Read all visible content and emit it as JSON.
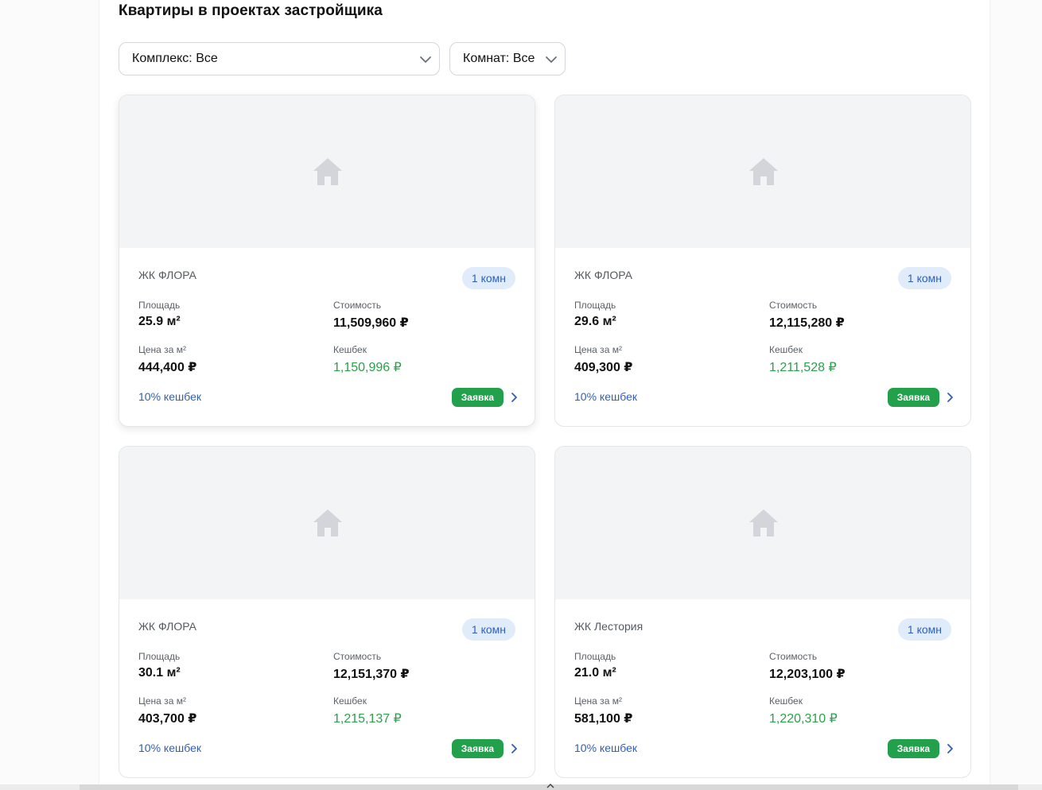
{
  "section": {
    "title": "Квартиры в проектах застройщика"
  },
  "filters": {
    "complex": "Комплекс: Все",
    "rooms": "Комнат: Все"
  },
  "labels": {
    "area": "Площадь",
    "cost": "Стоимость",
    "price_per_m2": "Цена за м²",
    "cashback": "Кешбек",
    "cashback_link": "10% кешбек",
    "apply": "Заявка"
  },
  "icons": {
    "photo_placeholder": "home-icon",
    "filter_chevron": "chevron-down-icon",
    "card_arrow": "chevron-right-icon"
  },
  "colors": {
    "accent_blue": "#2f5fb8",
    "cashback_green": "#2aa14a",
    "button_green": "#22a04b",
    "badge_bg": "#e1ecfb"
  },
  "cards": [
    {
      "complex": "ЖК ФЛОРА",
      "rooms": "1 комн",
      "area": "25.9 м²",
      "cost": "11,509,960 ₽",
      "price_per_m2": "444,400 ₽",
      "cashback": "1,150,996 ₽"
    },
    {
      "complex": "ЖК ФЛОРА",
      "rooms": "1 комн",
      "area": "29.6 м²",
      "cost": "12,115,280 ₽",
      "price_per_m2": "409,300 ₽",
      "cashback": "1,211,528 ₽"
    },
    {
      "complex": "ЖК ФЛОРА",
      "rooms": "1 комн",
      "area": "30.1 м²",
      "cost": "12,151,370 ₽",
      "price_per_m2": "403,700 ₽",
      "cashback": "1,215,137 ₽"
    },
    {
      "complex": "ЖК Лестория",
      "rooms": "1 комн",
      "area": "21.0 м²",
      "cost": "12,203,100 ₽",
      "price_per_m2": "581,100 ₽",
      "cashback": "1,220,310 ₽"
    }
  ]
}
